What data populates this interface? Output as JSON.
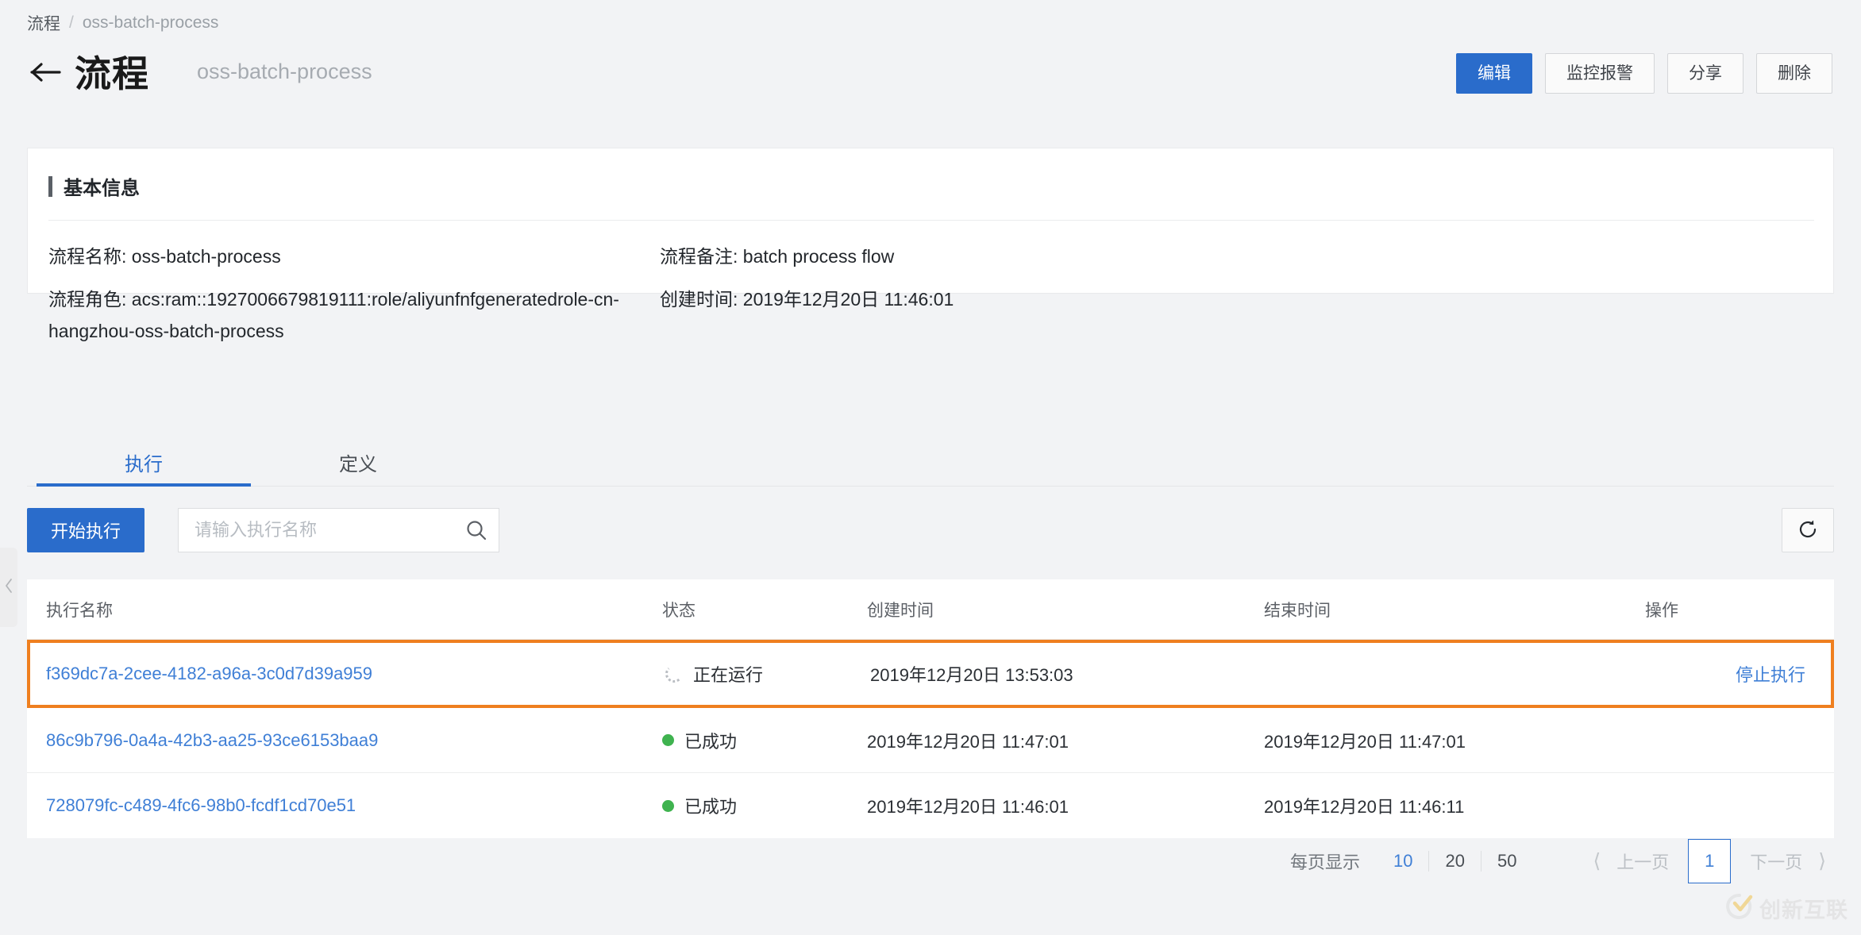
{
  "breadcrumb": {
    "root": "流程",
    "separator": "/",
    "current": "oss-batch-process"
  },
  "header": {
    "back_icon": "arrow-left-icon",
    "title": "流程",
    "subtitle": "oss-batch-process",
    "actions": [
      {
        "label": "编辑",
        "primary": true
      },
      {
        "label": "监控报警",
        "primary": false
      },
      {
        "label": "分享",
        "primary": false
      },
      {
        "label": "删除",
        "primary": false
      }
    ]
  },
  "info_card": {
    "title": "基本信息",
    "flow_name": "流程名称: oss-batch-process",
    "flow_remark": "流程备注: batch process flow",
    "flow_role": "流程角色: acs:ram::1927006679819111:role/aliyunfnfgeneratedrole-cn-hangzhou-oss-batch-process",
    "create_time": "创建时间: 2019年12月20日 11:46:01"
  },
  "tabs": [
    {
      "label": "执行",
      "active": true
    },
    {
      "label": "定义",
      "active": false
    }
  ],
  "toolbar": {
    "start_label": "开始执行",
    "search_placeholder": "请输入执行名称",
    "search_value": "",
    "search_icon": "search-icon",
    "refresh_icon": "refresh-icon"
  },
  "table": {
    "columns": [
      "执行名称",
      "状态",
      "创建时间",
      "结束时间",
      "操作"
    ],
    "rows": [
      {
        "name": "f369dc7a-2cee-4182-a96a-3c0d7d39a959",
        "status": "正在运行",
        "status_type": "running",
        "create_time": "2019年12月20日 13:53:03",
        "end_time": "",
        "action": "停止执行",
        "highlighted": true
      },
      {
        "name": "86c9b796-0a4a-42b3-aa25-93ce6153baa9",
        "status": "已成功",
        "status_type": "success",
        "create_time": "2019年12月20日 11:47:01",
        "end_time": "2019年12月20日 11:47:01",
        "action": "",
        "highlighted": false
      },
      {
        "name": "728079fc-c489-4fc6-98b0-fcdf1cd70e51",
        "status": "已成功",
        "status_type": "success",
        "create_time": "2019年12月20日 11:46:01",
        "end_time": "2019年12月20日 11:46:11",
        "action": "",
        "highlighted": false
      }
    ]
  },
  "pagination": {
    "label": "每页显示",
    "sizes": [
      "10",
      "20",
      "50"
    ],
    "active_size": "10",
    "prev_label": "上一页",
    "next_label": "下一页",
    "current_page": "1",
    "prev_icon": "chevron-left-icon",
    "next_icon": "chevron-right-icon"
  },
  "collapse_handle": {
    "icon": "chevron-left-icon"
  },
  "watermark": {
    "text": "创新互联",
    "icon": "brand-logo-icon"
  },
  "colors": {
    "primary": "#2a6ccb",
    "link": "#3f7fd6",
    "success": "#3fb34f",
    "highlight_border": "#ef7f1f",
    "page_bg": "#f2f3f5",
    "card_bg": "#ffffff"
  }
}
